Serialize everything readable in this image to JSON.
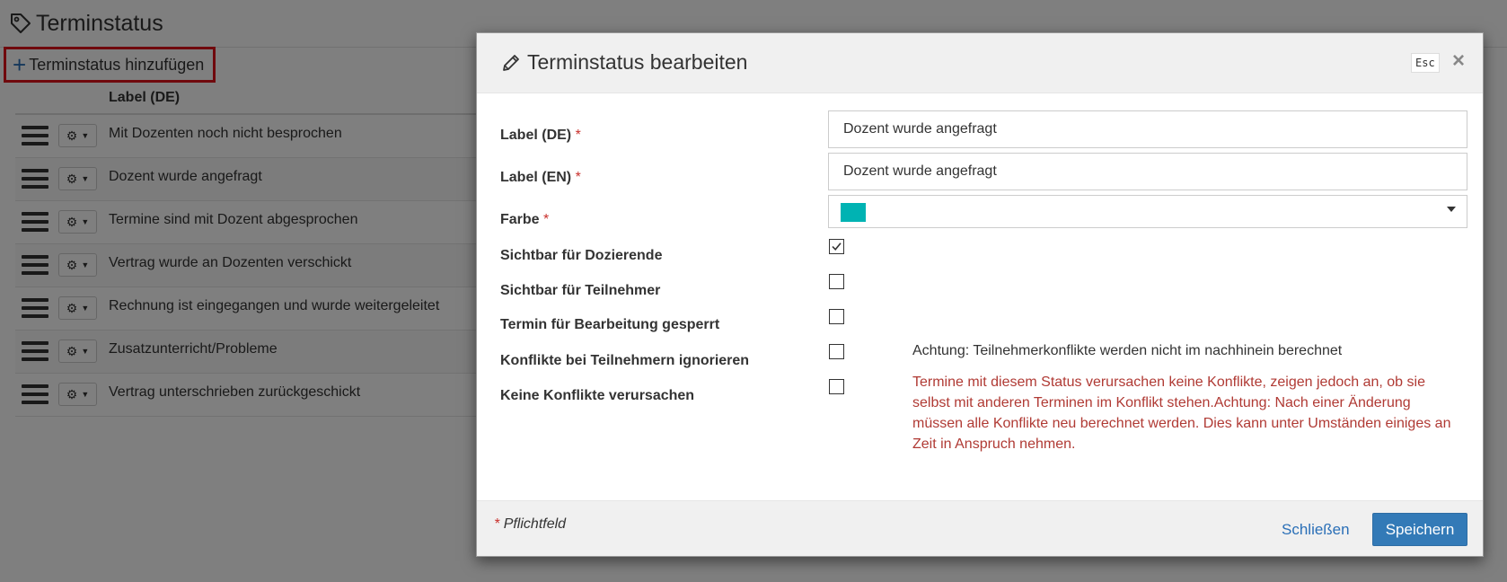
{
  "page": {
    "title": "Terminstatus",
    "add_button_label": "Terminstatus hinzufügen",
    "column_label": "Label (DE)",
    "rows": [
      {
        "label": "Mit Dozenten noch nicht besprochen"
      },
      {
        "label": "Dozent wurde angefragt"
      },
      {
        "label": "Termine sind mit Dozent abgesprochen"
      },
      {
        "label": "Vertrag wurde an Dozenten verschickt"
      },
      {
        "label": "Rechnung ist eingegangen und wurde weitergeleitet"
      },
      {
        "label": "Zusatzunterricht/Probleme"
      },
      {
        "label": "Vertrag unterschrieben zurückgeschickt"
      }
    ]
  },
  "modal": {
    "title": "Terminstatus bearbeiten",
    "esc_label": "Esc",
    "close_symbol": "×",
    "required_marker": "*",
    "fields": {
      "label_de": {
        "label": "Label (DE)",
        "value": "Dozent wurde angefragt"
      },
      "label_en": {
        "label": "Label (EN)",
        "value": "Dozent wurde angefragt"
      },
      "color": {
        "label": "Farbe",
        "value": "#00b3b3"
      },
      "visible_lecturers": {
        "label": "Sichtbar für Dozierende",
        "checked": true
      },
      "visible_participants": {
        "label": "Sichtbar für Teilnehmer",
        "checked": false
      },
      "locked": {
        "label": "Termin für Bearbeitung gesperrt",
        "checked": false
      },
      "ignore_conflicts": {
        "label": "Konflikte bei Teilnehmern ignorieren",
        "checked": false,
        "note": "Achtung: Teilnehmerkonflikte werden nicht im nachhinein berechnet"
      },
      "no_conflicts": {
        "label": "Keine Konflikte verursachen",
        "checked": false,
        "warning": "Termine mit diesem Status verursachen keine Konflikte, zeigen jedoch an, ob sie selbst mit anderen Terminen im Konflikt stehen.Achtung: Nach einer Änderung müssen alle Konflikte neu berechnet werden. Dies kann unter Umständen einiges an Zeit in Anspruch nehmen."
      }
    },
    "footer": {
      "required_note": "Pflichtfeld",
      "close_label": "Schließen",
      "save_label": "Speichern"
    }
  },
  "colors": {
    "primary": "#337ab7",
    "link": "#2a6fb7",
    "highlight_border": "#e0131b",
    "warning_text": "#b03a34",
    "required": "#c9302c"
  }
}
